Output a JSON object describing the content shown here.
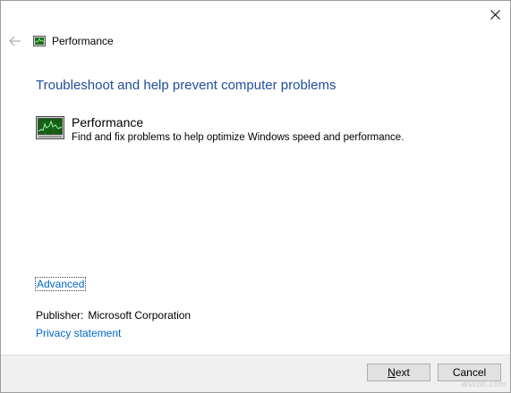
{
  "window": {
    "close_icon": "close-icon"
  },
  "header": {
    "back_icon": "back-arrow-icon",
    "app_icon": "performance-monitor-icon",
    "title": "Performance"
  },
  "main": {
    "heading": "Troubleshoot and help prevent computer problems",
    "tool": {
      "icon": "performance-monitor-icon",
      "name": "Performance",
      "description": "Find and fix problems to help optimize Windows speed and performance."
    },
    "advanced_link": "Advanced",
    "publisher_label": "Publisher:",
    "publisher_value": "Microsoft Corporation",
    "privacy_link": "Privacy statement"
  },
  "footer": {
    "next_mnemonic": "N",
    "next_rest": "ext",
    "cancel_label": "Cancel"
  },
  "watermark": "wsxdn.com",
  "colors": {
    "heading": "#1f4e99",
    "link": "#0066cc",
    "footer_bg": "#f0f0f0",
    "button_bg": "#e1e1e1",
    "icon_screen": "#1d6a1d"
  }
}
